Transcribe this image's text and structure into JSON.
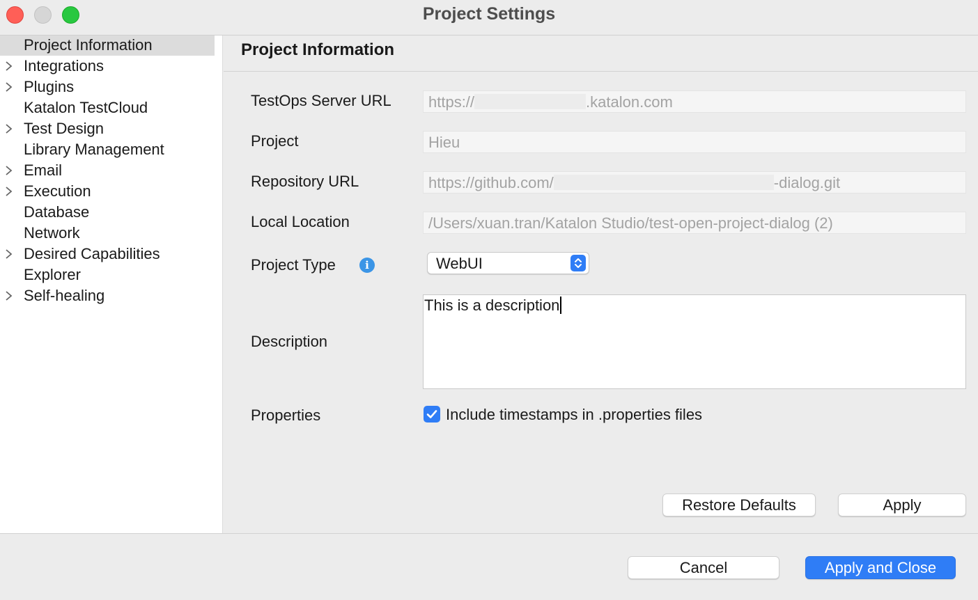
{
  "window": {
    "title": "Project Settings"
  },
  "sidebar": {
    "items": [
      {
        "label": "Project Information",
        "expandable": false,
        "selected": true
      },
      {
        "label": "Integrations",
        "expandable": true
      },
      {
        "label": "Plugins",
        "expandable": true
      },
      {
        "label": "Katalon TestCloud",
        "expandable": false
      },
      {
        "label": "Test Design",
        "expandable": true
      },
      {
        "label": "Library Management",
        "expandable": false
      },
      {
        "label": "Email",
        "expandable": true
      },
      {
        "label": "Execution",
        "expandable": true
      },
      {
        "label": "Database",
        "expandable": false
      },
      {
        "label": "Network",
        "expandable": false
      },
      {
        "label": "Desired Capabilities",
        "expandable": true
      },
      {
        "label": "Explorer",
        "expandable": false
      },
      {
        "label": "Self-healing",
        "expandable": true
      }
    ]
  },
  "main": {
    "section_title": "Project Information",
    "fields": {
      "server_url": {
        "label": "TestOps Server URL",
        "prefix": "https://",
        "suffix": ".katalon.com"
      },
      "project": {
        "label": "Project",
        "value": "Hieu"
      },
      "repo_url": {
        "label": "Repository URL",
        "prefix": "https://github.com/",
        "suffix": "-dialog.git"
      },
      "local_location": {
        "label": "Local Location",
        "value": "/Users/xuan.tran/Katalon Studio/test-open-project-dialog (2)"
      },
      "project_type": {
        "label": "Project Type",
        "value": "WebUI",
        "info_icon": "info-icon"
      },
      "description": {
        "label": "Description",
        "value": "This is a description"
      },
      "properties": {
        "label": "Properties",
        "checkbox_label": "Include timestamps in .properties files",
        "checked": true
      }
    },
    "buttons": {
      "restore_defaults": "Restore Defaults",
      "apply": "Apply"
    }
  },
  "footer": {
    "cancel": "Cancel",
    "apply_and_close": "Apply and Close"
  },
  "colors": {
    "accent": "#2f7df6",
    "selection": "#dcdcdc",
    "close": "#ff5f57",
    "maximize": "#28c840"
  }
}
